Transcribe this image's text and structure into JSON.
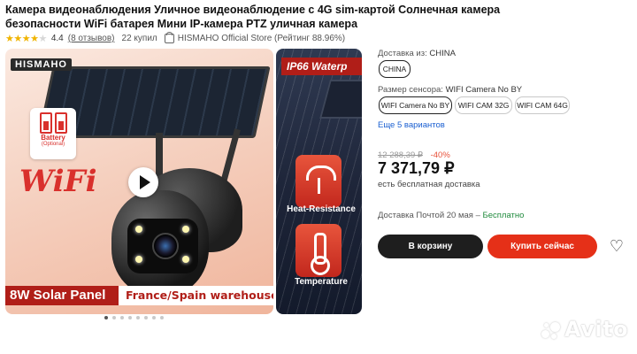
{
  "product": {
    "title": "Камера видеонаблюдения Уличное видеонаблюдение с 4G sim-картой Солнечная камера безопасности WiFi батарея Мини IP-камера PTZ уличная камера",
    "rating_value": "4.4",
    "rating_stars": 4.4,
    "reviews_link": "(8 отзывов)",
    "bought": "22 купил",
    "shop": "HISMAHO Official Store (Рейтинг 88.96%)"
  },
  "main_image": {
    "brand": "HISMAHO",
    "battery_label": "Battery",
    "battery_sub": "(Optional)",
    "wifi_text": "WiFi",
    "banner_left": "8W Solar Panel",
    "banner_right": "France/Spain warehouse",
    "slides_total": 8,
    "slide_active": 1
  },
  "side_image": {
    "header": "IP66 Waterp",
    "feature_1": "Heat-Resistance",
    "feature_2": "Temperature"
  },
  "options": {
    "ship_from_label": "Доставка из:",
    "ship_from_value": "CHINA",
    "ship_chip": "CHINA",
    "sensor_label": "Размер сенсора:",
    "sensor_value": "WIFI Camera No BY",
    "variants": [
      "WIFI Camera No BY",
      "WIFI CAM 32G",
      "WIFI CAM 64G"
    ],
    "more_link": "Еще 5 вариантов"
  },
  "pricing": {
    "old_price": "12 288,39 ₽",
    "discount": "-40%",
    "price": "7 371,79 ₽",
    "shipping_note": "есть бесплатная доставка",
    "delivery_text": "Доставка Почтой 20 мая –",
    "delivery_free": "Бесплатно"
  },
  "actions": {
    "cart": "В корзину",
    "buy": "Купить сейчас"
  },
  "watermark": "Avito",
  "colors": {
    "accent_red": "#e53018",
    "star": "#f0b400",
    "link_blue": "#1a5fd1",
    "free_green": "#1f8a3c"
  }
}
